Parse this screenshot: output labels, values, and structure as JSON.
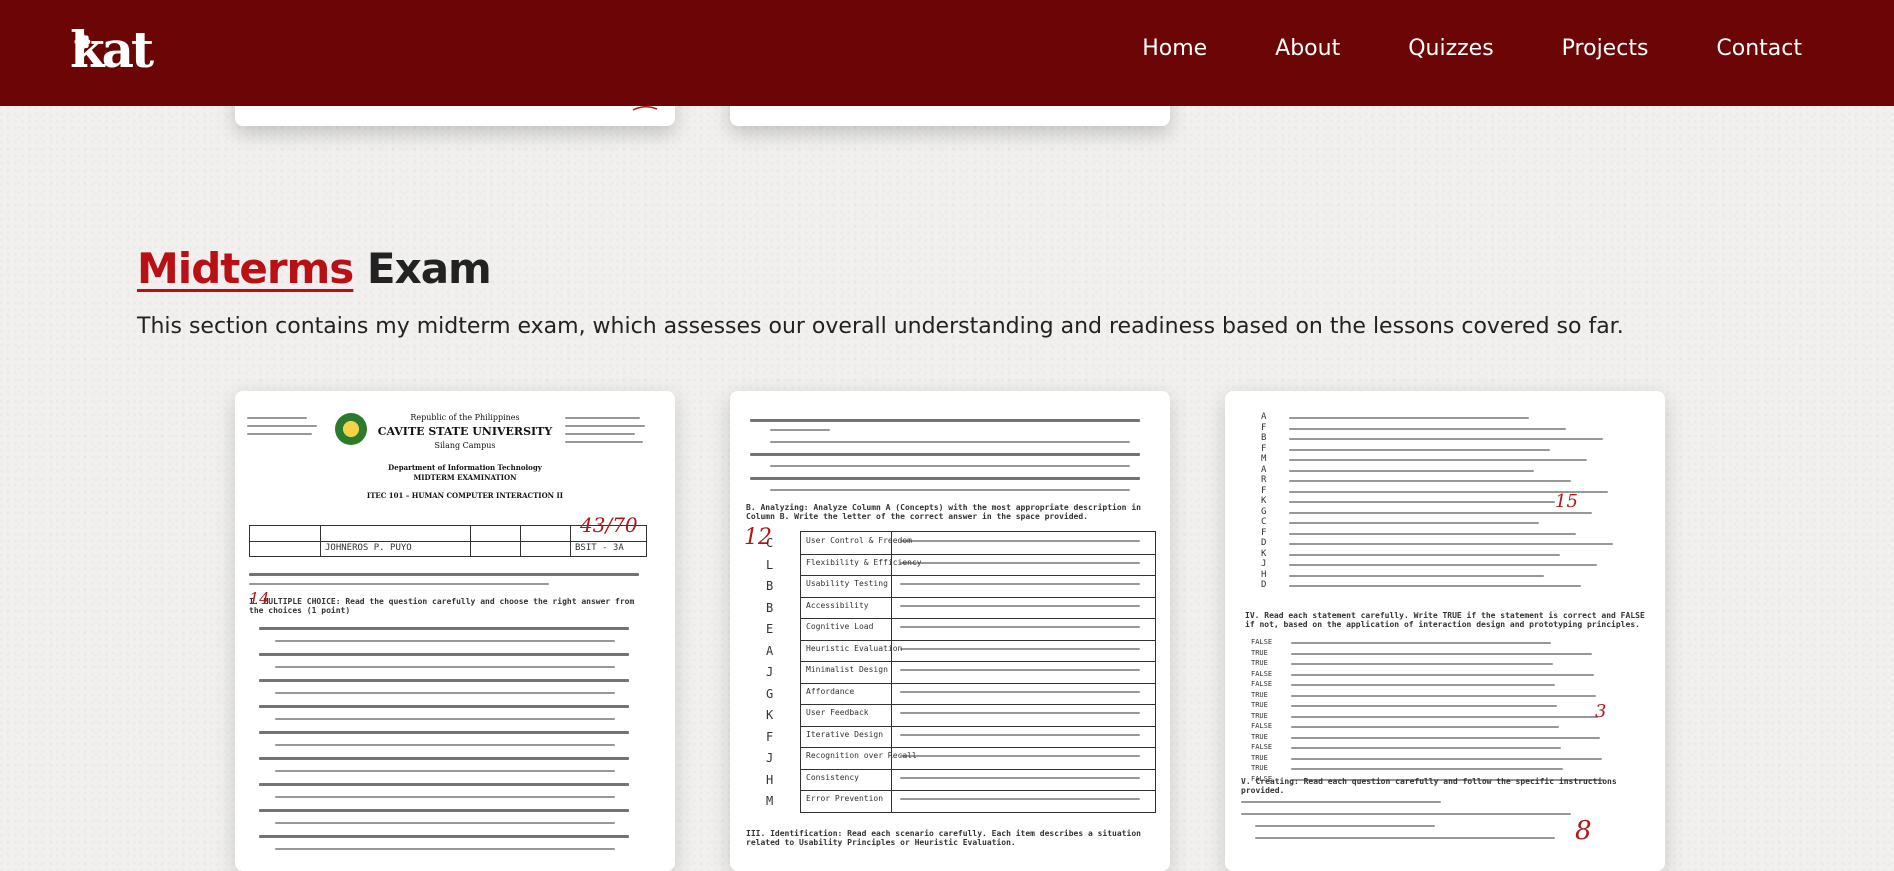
{
  "navbar": {
    "logo_text": "kat",
    "links": [
      "Home",
      "About",
      "Quizzes",
      "Projects",
      "Contact"
    ]
  },
  "section": {
    "title_accent": "Midterms",
    "title_rest": " Exam",
    "description": "This section contains my midterm exam, which assesses our overall understanding and readiness based on the lessons covered so far."
  },
  "exam_pages": {
    "page1": {
      "republic": "Republic of the Philippines",
      "university": "CAVITE STATE UNIVERSITY",
      "campus": "Silang Campus",
      "dept": "Department of Information Technology",
      "exam": "MIDTERM EXAMINATION",
      "course": "ITEC 101 – HUMAN COMPUTER INTERACTION II",
      "score": "43/70",
      "instructor": "JOHNEROS P. PUYO",
      "section_label": "BSIT - 3A",
      "test_heading": "I. MULTIPLE CHOICE: Read the question carefully and choose the right answer from the choices (1 point)"
    },
    "page2": {
      "heading": "B. Analyzing: Analyze Column A (Concepts) with the most appropriate description in Column B. Write the letter of the correct answer in the space provided.",
      "score_mark": "12",
      "concepts": [
        "User Control & Freedom",
        "Flexibility & Efficiency",
        "Usability Testing",
        "Accessibility",
        "Cognitive Load",
        "Heuristic Evaluation",
        "Minimalist Design",
        "Affordance",
        "User Feedback",
        "Iterative Design",
        "Recognition over Recall",
        "Consistency",
        "Error Prevention"
      ],
      "answers": [
        "C",
        "L",
        "B",
        "B",
        "E",
        "A",
        "J",
        "G",
        "K",
        "F",
        "J",
        "H",
        "M"
      ],
      "footer": "III. Identification: Read each scenario carefully. Each item describes a situation related to Usability Principles or Heuristic Evaluation."
    },
    "page3": {
      "answers": [
        "A",
        "F",
        "B",
        "F",
        "M",
        "A",
        "R",
        "F",
        "K",
        "G",
        "C",
        "F",
        "D",
        "K",
        "J",
        "H",
        "D"
      ],
      "score_mark_1": "15",
      "heading": "IV. Read each statement carefully. Write TRUE if the statement is correct and FALSE if not, based on the application of interaction design and prototyping principles.",
      "tf_answers": [
        "FALSE",
        "TRUE",
        "TRUE",
        "FALSE",
        "FALSE",
        "TRUE",
        "TRUE",
        "TRUE",
        "FALSE",
        "TRUE",
        "FALSE",
        "TRUE",
        "TRUE",
        "FALSE"
      ],
      "score_mark_2": "3",
      "creating": "V. Creating: Read each question carefully and follow the specific instructions provided.",
      "score_mark_3": "8"
    }
  },
  "colors": {
    "navbar_bg": "#6b0506",
    "accent_red": "#b81014",
    "page_bg": "#f1f0ee"
  }
}
